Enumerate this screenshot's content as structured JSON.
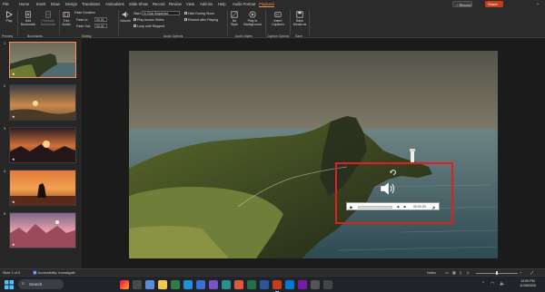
{
  "menubar": {
    "tabs": [
      "File",
      "Home",
      "Insert",
      "Draw",
      "Design",
      "Transitions",
      "Animations",
      "Slide Show",
      "Record",
      "Review",
      "View",
      "Add-ins",
      "Help",
      "Audio Format",
      "Playback"
    ],
    "active_tab": "Playback",
    "record_label": "Record",
    "share_label": "Share"
  },
  "ribbon": {
    "play_label": "Play",
    "add_bookmark_label": "Add Bookmark",
    "remove_bookmark_label": "Remove Bookmark",
    "trim_audio_label": "Trim Audio",
    "fade_duration_label": "Fade Duration",
    "fade_in_label": "Fade In:",
    "fade_in_value": "00.00",
    "fade_out_label": "Fade Out:",
    "fade_out_value": "00.00",
    "volume_label": "Volume",
    "start_label": "Start:",
    "start_value": "In Click Sequence",
    "play_across_label": "Play Across Slides",
    "loop_label": "Loop until Stopped",
    "hide_label": "Hide During Show",
    "rewind_label": "Rewind after Playing",
    "no_style_label": "No Style",
    "play_bg_label": "Play in Background",
    "insert_captions_label": "Insert Captions",
    "save_media_label": "Save Media as",
    "groups": [
      "Preview",
      "Bookmarks",
      "Editing",
      "Audio Options",
      "Audio Styles",
      "Caption Options",
      "Save"
    ]
  },
  "slides": {
    "numbers": [
      "1",
      "2",
      "3",
      "4",
      "5"
    ],
    "selected_index": 0,
    "star": "★"
  },
  "media": {
    "time": "00:00.00",
    "play_glyph": "▶",
    "back_glyph": "◀",
    "fwd_glyph": "▶",
    "vol_glyph": "🔈"
  },
  "statusbar": {
    "slide_info": "Slide 1 of 5",
    "accessibility": "Accessibility: Investigate",
    "notes": "Notes",
    "zoom": "+"
  },
  "taskbar": {
    "search_placeholder": "Search",
    "time": "12:00 PM",
    "date": "11/26/2020"
  },
  "colors": {
    "accent": "#ff8a5c",
    "share": "#c43e1c",
    "selection": "#e02020"
  }
}
